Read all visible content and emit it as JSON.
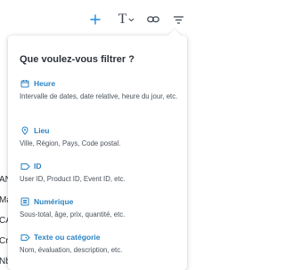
{
  "toolbar": {
    "items": [
      "plus-icon",
      "text-format-icon",
      "link-icon",
      "filter-icon"
    ],
    "text_glyph": "T"
  },
  "left_edge": {
    "fragments": [
      "AN",
      "Ma",
      "CA",
      "Cr",
      "Nb"
    ]
  },
  "filter_panel": {
    "title": "Que voulez-vous filtrer ?",
    "options": [
      {
        "icon": "calendar-icon",
        "label": "Heure",
        "description": "Intervalle de dates, date relative, heure du jour, etc."
      },
      {
        "icon": "location-pin-icon",
        "label": "Lieu",
        "description": "Ville, Région, Pays, Code postal."
      },
      {
        "icon": "id-tag-icon",
        "label": "ID",
        "description": "User ID, Product ID, Event ID, etc."
      },
      {
        "icon": "number-list-icon",
        "label": "Numérique",
        "description": "Sous-total, âge, prix, quantité, etc."
      },
      {
        "icon": "text-tag-icon",
        "label": "Texte ou catégorie",
        "description": "Nom, évaluation, description, etc."
      }
    ]
  },
  "colors": {
    "accent": "#2a83c4",
    "toolbar_blue": "#1e88e5",
    "title_text": "#2b323a",
    "description_text": "#4a525b"
  }
}
